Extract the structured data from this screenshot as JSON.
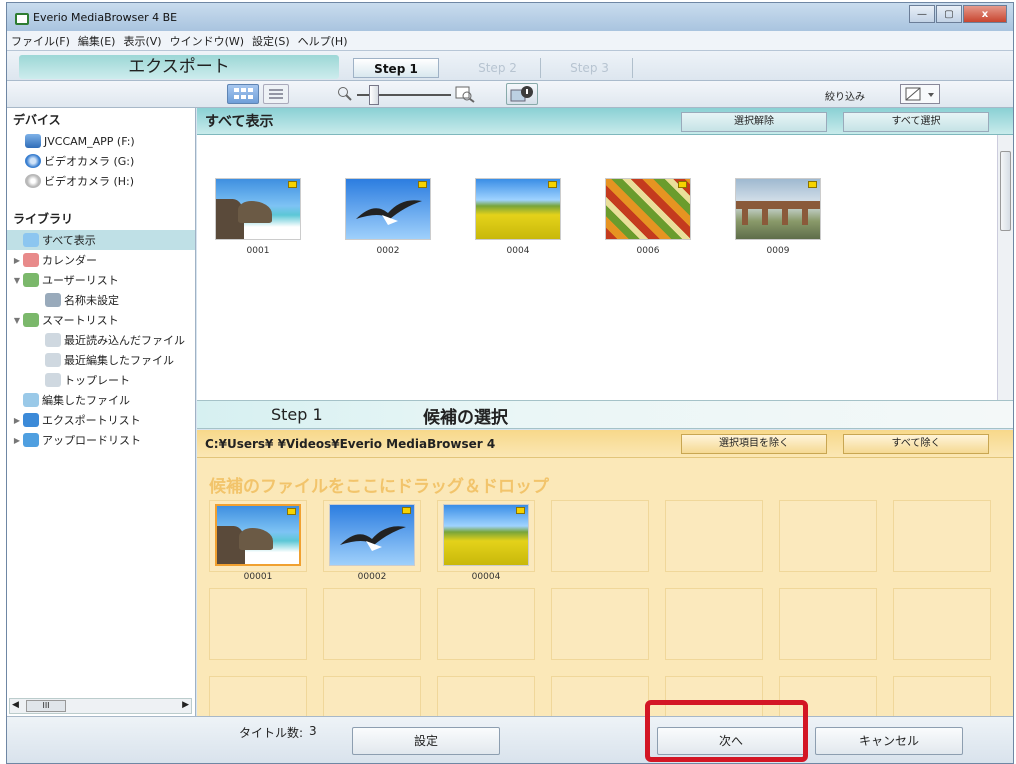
{
  "window": {
    "title": "Everio MediaBrowser 4 BE",
    "controls": [
      "—",
      "▢",
      "x"
    ]
  },
  "menu": [
    "ファイル(F)",
    "編集(E)",
    "表示(V)",
    "ウインドウ(W)",
    "設定(S)",
    "ヘルプ(H)"
  ],
  "stepbar": {
    "mode_title": "エクスポート",
    "steps": [
      "Step 1",
      "Step 2",
      "Step 3"
    ],
    "active_step": 0
  },
  "toolbar": {
    "filter_label": "絞り込み"
  },
  "sidebar": {
    "devices_heading": "デバイス",
    "devices": [
      "JVCCAM_APP (F:)",
      "ビデオカメラ (G:)",
      "ビデオカメラ (H:)"
    ],
    "library_heading": "ライブラリ",
    "library": [
      {
        "label": "すべて表示",
        "selected": true,
        "arrow": ""
      },
      {
        "label": "カレンダー",
        "arrow": "▶"
      },
      {
        "label": "ユーザーリスト",
        "arrow": "▼"
      },
      {
        "label": "名称未設定",
        "arrow": "",
        "indent": true
      },
      {
        "label": "スマートリスト",
        "arrow": "▼"
      },
      {
        "label": "最近読み込んだファイル",
        "arrow": "",
        "indent": true
      },
      {
        "label": "最近編集したファイル",
        "arrow": "",
        "indent": true
      },
      {
        "label": "トップレート",
        "arrow": "",
        "indent": true
      },
      {
        "label": "編集したファイル",
        "arrow": ""
      },
      {
        "label": "エクスポートリスト",
        "arrow": "▶"
      },
      {
        "label": "アップロードリスト",
        "arrow": "▶"
      }
    ]
  },
  "browser": {
    "title": "すべて表示",
    "deselect_label": "選択解除",
    "select_all_label": "すべて選択",
    "items": [
      {
        "id": "0001",
        "scene": "beach"
      },
      {
        "id": "0002",
        "scene": "bird"
      },
      {
        "id": "0004",
        "scene": "field"
      },
      {
        "id": "0006",
        "scene": "market"
      },
      {
        "id": "0009",
        "scene": "bridge"
      }
    ]
  },
  "step_section": {
    "step": "Step 1",
    "title": "候補の選択"
  },
  "candidates": {
    "path": "C:¥Users¥ ¥Videos¥Everio MediaBrowser 4",
    "remove_selected_label": "選択項目を除く",
    "remove_all_label": "すべて除く",
    "drop_hint": "候補のファイルをここにドラッグ＆ドロップ",
    "items": [
      {
        "id": "00001",
        "scene": "beach"
      },
      {
        "id": "00002",
        "scene": "bird"
      },
      {
        "id": "00004",
        "scene": "field"
      }
    ]
  },
  "footer": {
    "title_count_label": "タイトル数:",
    "title_count": "3",
    "settings_label": "設定",
    "next_label": "次へ",
    "cancel_label": "キャンセル"
  },
  "sidebar_scroll": {
    "label": "III"
  }
}
